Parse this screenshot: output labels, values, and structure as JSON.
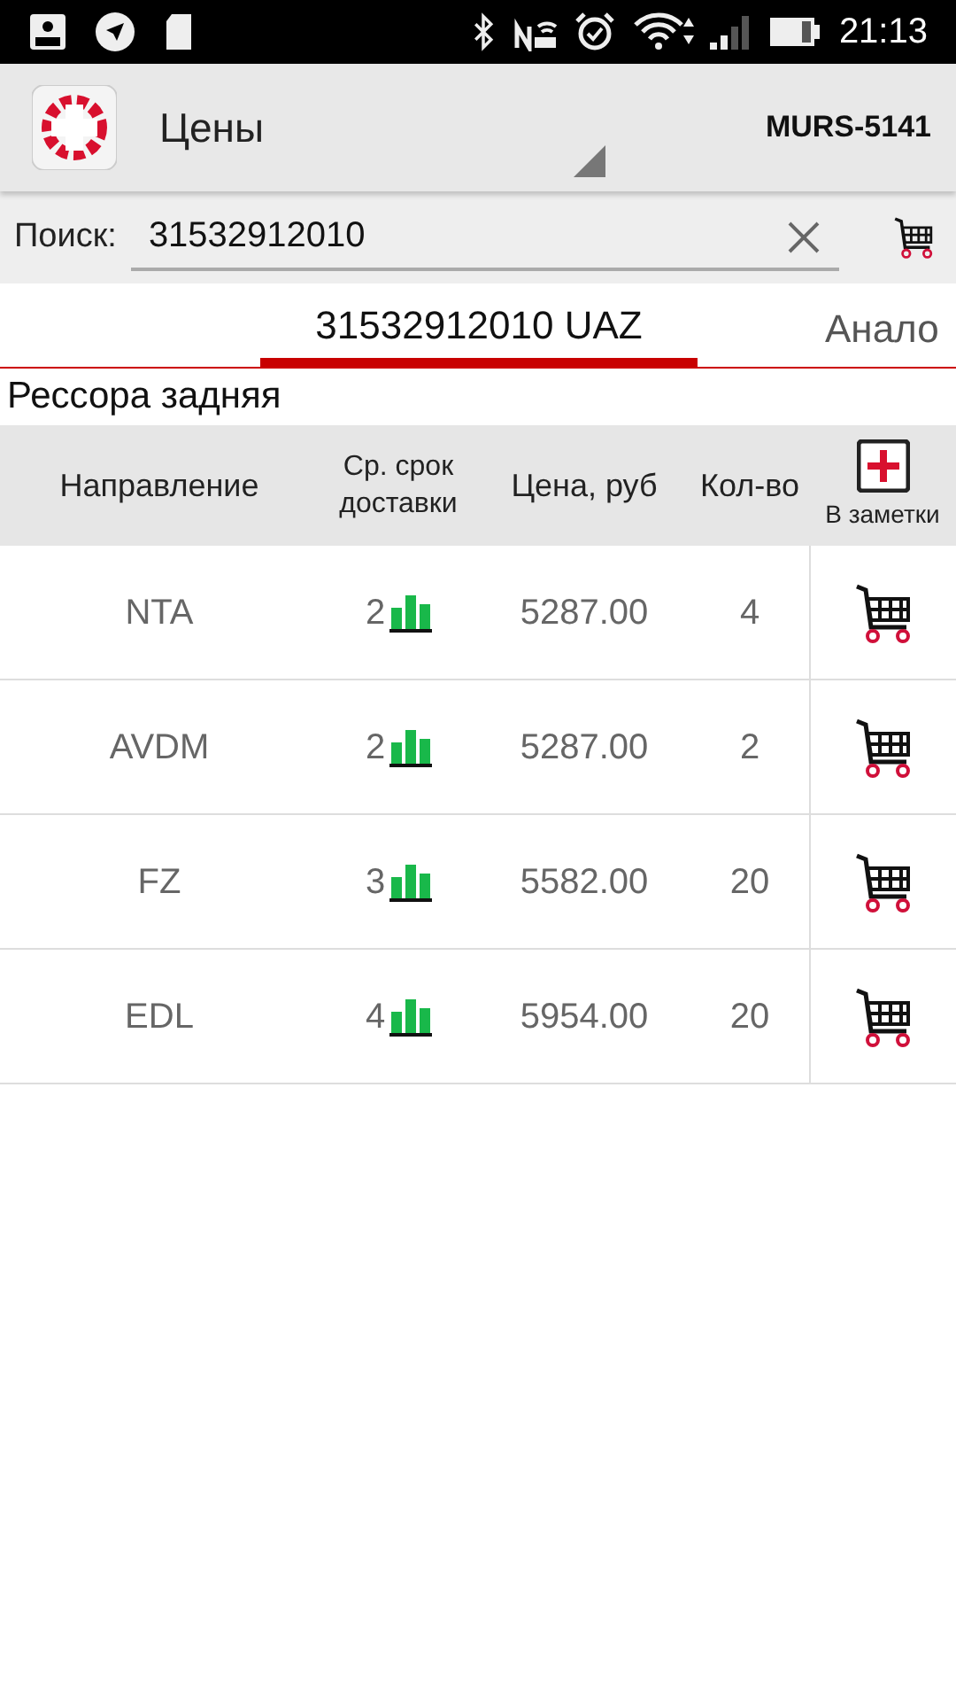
{
  "status_bar": {
    "time": "21:13"
  },
  "app_bar": {
    "title": "Цены",
    "account": "MURS-5141"
  },
  "search": {
    "label": "Поиск:",
    "value": "31532912010"
  },
  "tabs": [
    {
      "label": "31532912010 UAZ",
      "selected": true
    },
    {
      "label": "Анало",
      "selected": false
    }
  ],
  "part_name": "Рессора задняя",
  "table": {
    "columns": [
      "Направление",
      "Ср. срок доставки",
      "Цена, руб",
      "Кол-во",
      "В заметки"
    ],
    "rows": [
      {
        "direction": "NTA",
        "delivery_days": "2",
        "price": "5287.00",
        "quantity": "4"
      },
      {
        "direction": "AVDM",
        "delivery_days": "2",
        "price": "5287.00",
        "quantity": "2"
      },
      {
        "direction": "FZ",
        "delivery_days": "3",
        "price": "5582.00",
        "quantity": "20"
      },
      {
        "direction": "EDL",
        "delivery_days": "4",
        "price": "5954.00",
        "quantity": "20"
      }
    ]
  }
}
